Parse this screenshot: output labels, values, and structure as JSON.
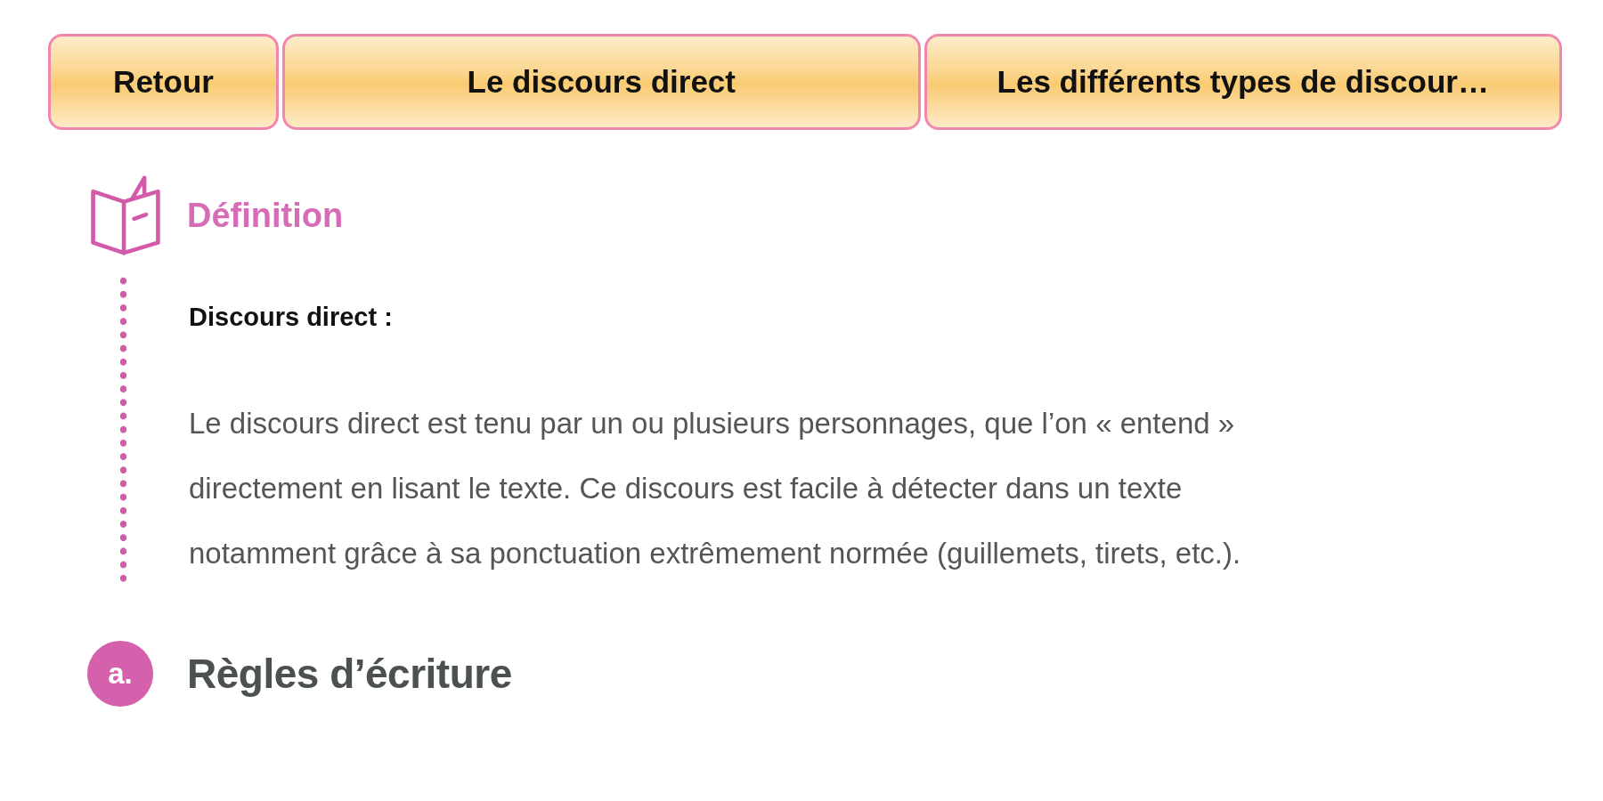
{
  "nav_buttons": [
    {
      "label": "Retour"
    },
    {
      "label": "Le discours direct"
    },
    {
      "label": "Les différents types de discour…"
    }
  ],
  "definition": {
    "title": "Définition",
    "term": "Discours direct :",
    "text": "Le discours direct est tenu par un ou plusieurs personnages, que l’on « entend » directement en lisant le texte. Ce discours est facile à détecter dans un texte notamment grâce à sa ponctuation extrêmement normée (guillemets, tirets, etc.)."
  },
  "section": {
    "marker": "a.",
    "title": "Règles d’écriture"
  }
}
